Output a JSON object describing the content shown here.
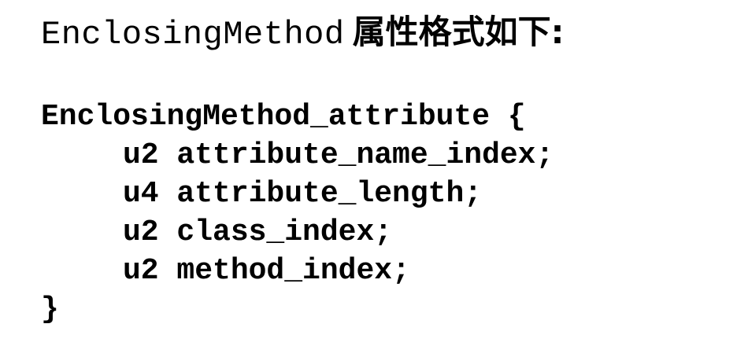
{
  "title": {
    "code_text": "EnclosingMethod",
    "chinese_text": "属性格式如下:"
  },
  "code_block": {
    "lines": [
      "EnclosingMethod_attribute {",
      "u2 attribute_name_index;",
      "u4 attribute_length;",
      "u2 class_index;",
      "u2 method_index;",
      "}"
    ]
  }
}
